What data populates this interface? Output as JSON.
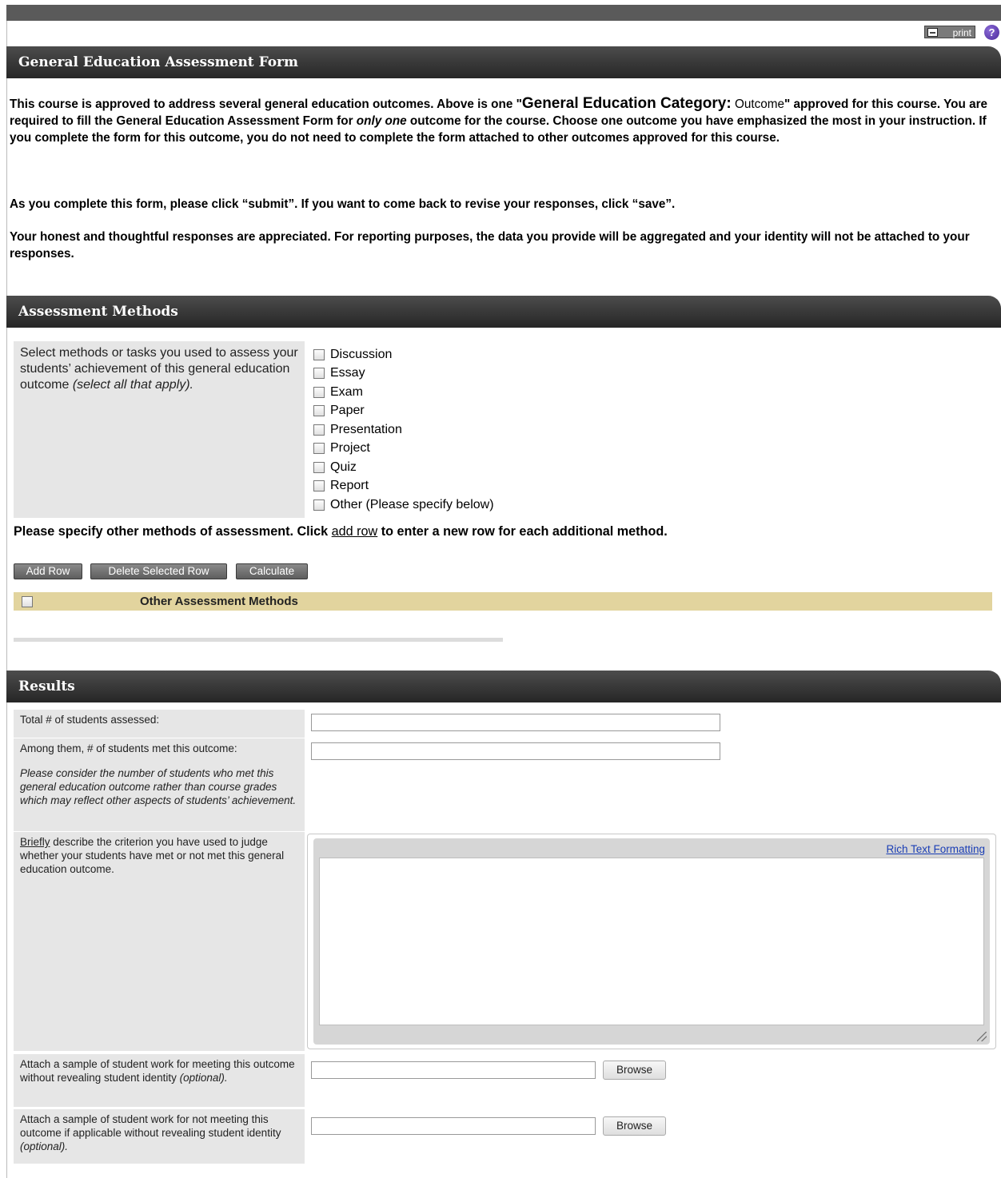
{
  "toolbar": {
    "print_label": "print",
    "help_label": "?"
  },
  "form": {
    "title": "General Education Assessment Form",
    "intro": {
      "p1_a": "This course is approved to address several general education outcomes. Above is one \"",
      "p1_category": "General Education Category:",
      "p1_outcome": " Outcome",
      "p1_b": "\" approved for this course. You are required to fill the General Education Assessment Form for ",
      "p1_em": "only one",
      "p1_c": " outcome for the course. Choose one outcome you have emphasized the most in your instruction. If you complete the form for this outcome, you do not need to complete the form attached to other outcomes approved for this course.",
      "p2": "As you complete this form, please click “submit”. If you want to come back to revise your responses, click “save”.",
      "p3": "Your honest and thoughtful responses are appreciated. For reporting purposes, the data you provide will be aggregated and your identity will not be attached to your responses."
    }
  },
  "assessment": {
    "title": "Assessment Methods",
    "label_main": "Select methods or tasks you used to assess your students’ achievement of this general education outcome ",
    "label_em": "(select all that apply).",
    "methods": [
      "Discussion",
      "Essay",
      "Exam",
      "Paper",
      "Presentation",
      "Project",
      "Quiz",
      "Report",
      "Other (Please specify below)"
    ],
    "specify_a": "Please specify other methods of assessment. Click ",
    "specify_link": "add row",
    "specify_b": " to enter a new row for each additional method.",
    "buttons": {
      "add": "Add Row",
      "delete": "Delete Selected Row",
      "calculate": "Calculate"
    },
    "grid_column": "Other Assessment Methods"
  },
  "results": {
    "title": "Results",
    "total_label": "Total # of students assessed:",
    "total_value": "",
    "met_label": "Among them, # of students met this outcome:",
    "met_value": "",
    "met_note": "Please consider the number of students who met this general education outcome rather than course grades which may reflect other aspects of students’ achievement.",
    "criterion_u": "Briefly",
    "criterion_rest": " describe the criterion you have used to judge whether your students have met or not met this general education outcome.",
    "rich_link": "Rich Text Formatting",
    "criterion_value": "",
    "attach_meet_label": "Attach a sample of student work for meeting this outcome without revealing student identity ",
    "attach_meet_em": "(optional).",
    "attach_notmeet_label": "Attach a sample of student work for not meeting this outcome if applicable without revealing student identity ",
    "attach_notmeet_em": "(optional).",
    "browse_label": "Browse"
  }
}
